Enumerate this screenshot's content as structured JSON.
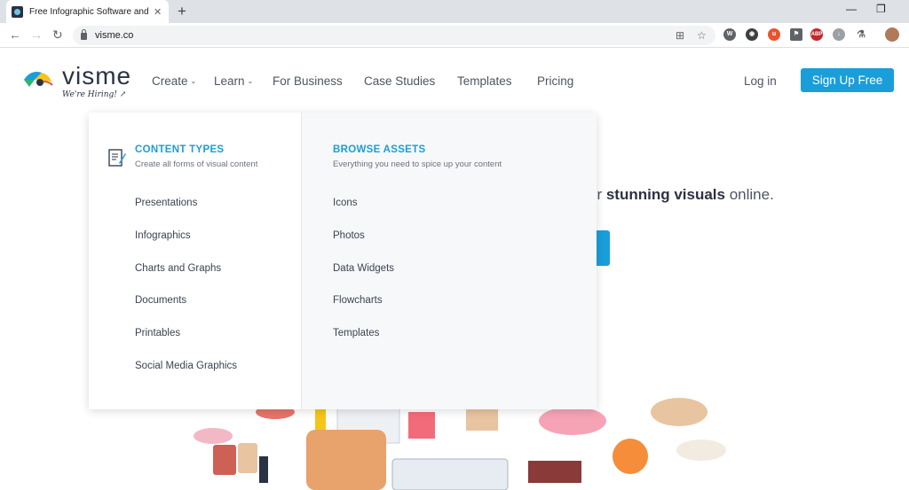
{
  "browser": {
    "tab_title": "Free Infographic Software and Pi",
    "tab_close": "✕",
    "new_tab": "+",
    "minimize": "—",
    "restore": "❐",
    "back": "←",
    "forward": "→",
    "reload": "↻",
    "url": "visme.co",
    "ext_abp": "ABP"
  },
  "header": {
    "logo_text": "visme",
    "logo_tagline": "We're Hiring! ↗",
    "nav": [
      {
        "label": "Create",
        "has_chevron": true
      },
      {
        "label": "Learn",
        "has_chevron": true
      },
      {
        "label": "For Business"
      },
      {
        "label": "Case Studies"
      },
      {
        "label": "Templates"
      },
      {
        "label": "Pricing"
      }
    ],
    "chevron": "⌄",
    "login": "Log in",
    "signup": "Sign Up Free"
  },
  "hero": {
    "text_prefix": "er ",
    "text_bold": "stunning visuals",
    "text_suffix": " online."
  },
  "dropdown": {
    "content_types": {
      "title": "CONTENT TYPES",
      "subtitle": "Create all forms of visual content",
      "items": [
        "Presentations",
        "Infographics",
        "Charts and Graphs",
        "Documents",
        "Printables",
        "Social Media Graphics"
      ]
    },
    "browse_assets": {
      "title": "BROWSE ASSETS",
      "subtitle": "Everything you need to spice up your content",
      "items": [
        "Icons",
        "Photos",
        "Data Widgets",
        "Flowcharts",
        "Templates"
      ]
    }
  },
  "colors": {
    "brand_blue": "#1a9ed9",
    "nav_text": "#4b5563",
    "logo_dark": "#2b3244"
  }
}
